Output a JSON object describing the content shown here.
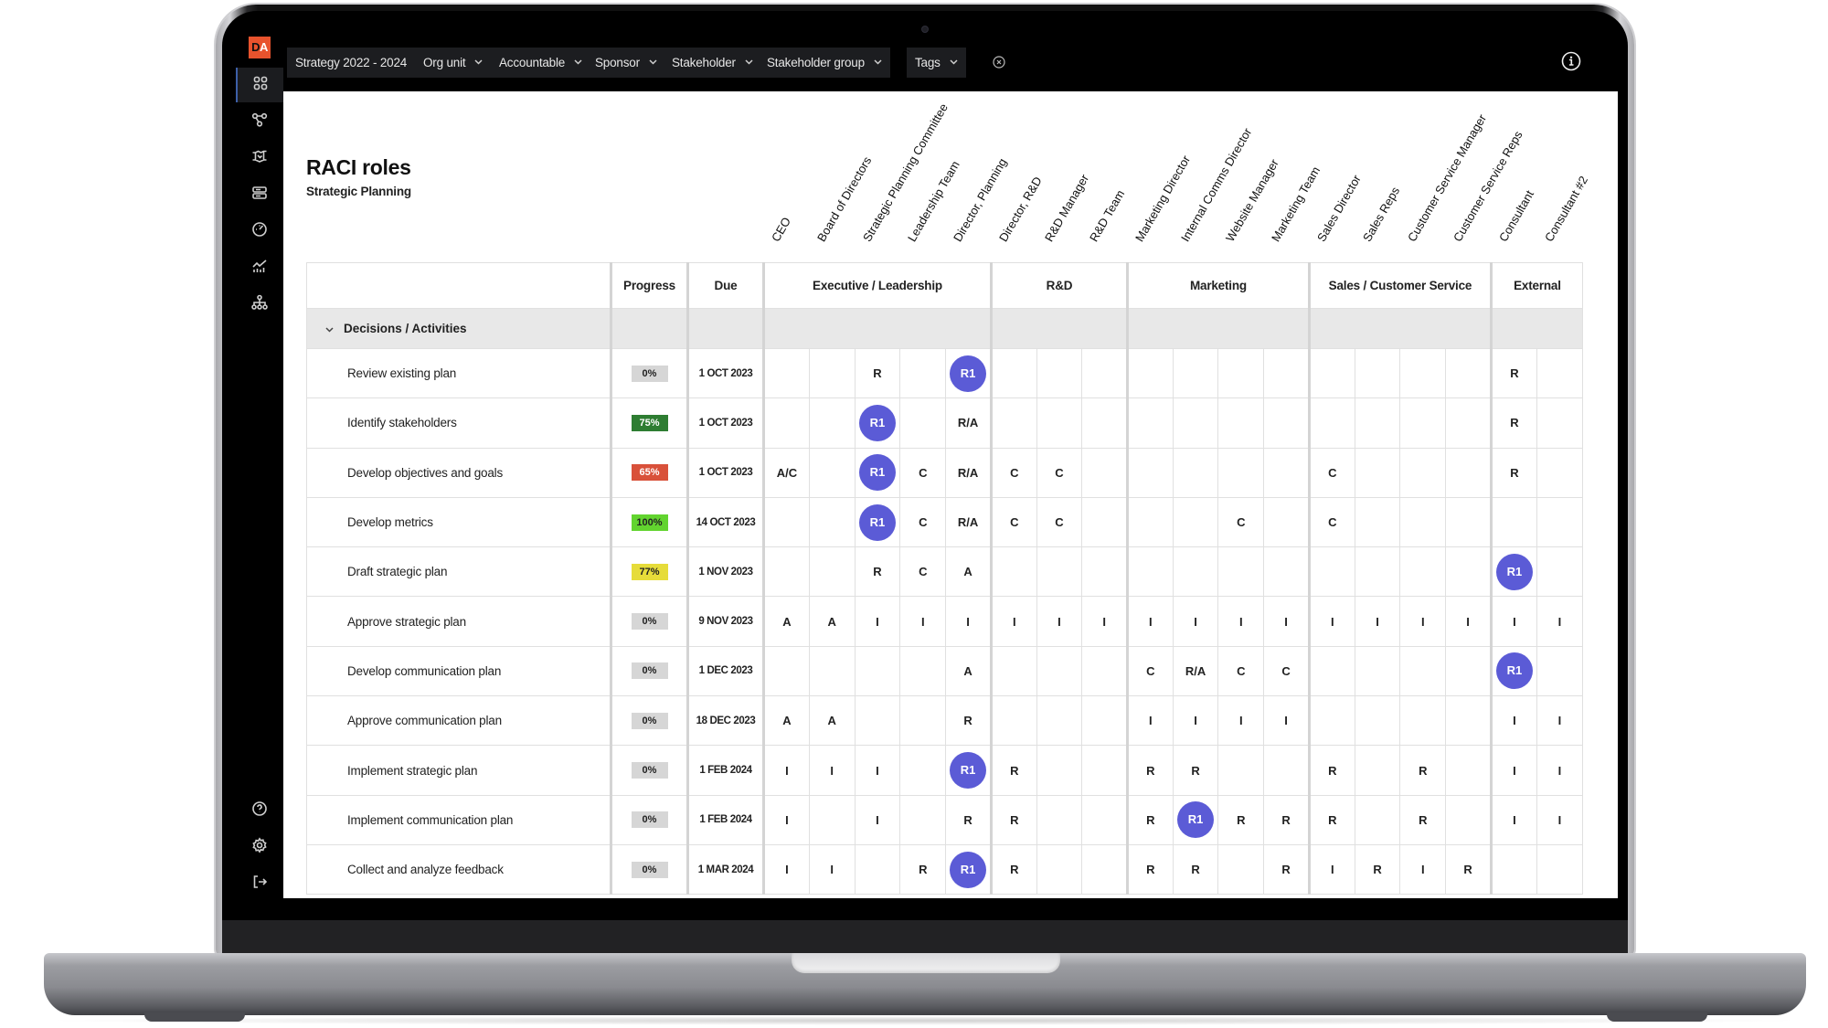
{
  "app": {
    "logo": {
      "first": "D",
      "second": "A"
    },
    "sidebar": {
      "top_items": [
        {
          "name": "dashboard",
          "icon": "grid-icon",
          "active": true
        },
        {
          "name": "relationships",
          "icon": "nodes-icon",
          "active": false
        },
        {
          "name": "handshake",
          "icon": "handshake-icon",
          "active": false
        },
        {
          "name": "layers",
          "icon": "stack-icon",
          "active": false
        },
        {
          "name": "performance",
          "icon": "gauge-icon",
          "active": false
        },
        {
          "name": "analytics",
          "icon": "chart-icon",
          "active": false
        },
        {
          "name": "org-chart",
          "icon": "hierarchy-icon",
          "active": false
        }
      ],
      "bottom_items": [
        {
          "name": "help",
          "icon": "help-icon"
        },
        {
          "name": "settings",
          "icon": "gear-icon"
        },
        {
          "name": "logout",
          "icon": "logout-icon"
        }
      ]
    },
    "filters": [
      {
        "label": "Strategy 2022 - 2024"
      },
      {
        "label": "Org unit"
      },
      {
        "label": "Accountable"
      },
      {
        "label": "Sponsor"
      },
      {
        "label": "Stakeholder"
      },
      {
        "label": "Stakeholder group"
      },
      {
        "label": "Tags"
      }
    ],
    "clear_filters_icon": "close-circle-icon",
    "info_icon": "info-icon"
  },
  "page": {
    "title": "RACI roles",
    "subtitle": "Strategic Planning"
  },
  "table": {
    "headers": {
      "activity": "",
      "progress": "Progress",
      "due": "Due"
    },
    "groups": [
      {
        "label": "Executive / Leadership",
        "span": 5
      },
      {
        "label": "R&D",
        "span": 3
      },
      {
        "label": "Marketing",
        "span": 4
      },
      {
        "label": "Sales / Customer Service",
        "span": 4
      },
      {
        "label": "External",
        "span": 2
      }
    ],
    "roles": [
      "CEO",
      "Board of Directors",
      "Strategic Planning Committee",
      "Leadership Team",
      "Director, Planning",
      "Director, R&D",
      "R&D Manager",
      "R&D Team",
      "Marketing Director",
      "Internal Comms Director",
      "Website Manager",
      "Marketing Team",
      "Sales Director",
      "Sales Reps",
      "Customer Service Manager",
      "Customer  Service Reps",
      "Consultant",
      "Consultant #2"
    ],
    "section": {
      "label": "Decisions / Activities",
      "expanded": true
    },
    "progress_colors": {
      "0": "#d6d6d6",
      "65": "#d9513a",
      "75": "#2e7d32",
      "77": "#e6dc3a",
      "100": "#62d42f"
    },
    "r1_color": "#5b5bd6",
    "rows": [
      {
        "activity": "Review existing plan",
        "progress": "0%",
        "progress_value": 0,
        "due": "1 OCT 2023",
        "cells": [
          "",
          "",
          "R",
          "",
          "R1",
          "",
          "",
          "",
          "",
          "",
          "",
          "",
          "",
          "",
          "",
          "",
          "R",
          ""
        ]
      },
      {
        "activity": "Identify stakeholders",
        "progress": "75%",
        "progress_value": 75,
        "due": "1 OCT 2023",
        "cells": [
          "",
          "",
          "R1",
          "",
          "R/A",
          "",
          "",
          "",
          "",
          "",
          "",
          "",
          "",
          "",
          "",
          "",
          "R",
          ""
        ]
      },
      {
        "activity": "Develop objectives and goals",
        "progress": "65%",
        "progress_value": 65,
        "due": "1 OCT 2023",
        "cells": [
          "A/C",
          "",
          "R1",
          "C",
          "R/A",
          "C",
          "C",
          "",
          "",
          "",
          "",
          "",
          "C",
          "",
          "",
          "",
          "R",
          ""
        ]
      },
      {
        "activity": "Develop metrics",
        "progress": "100%",
        "progress_value": 100,
        "due": "14 OCT 2023",
        "cells": [
          "",
          "",
          "R1",
          "C",
          "R/A",
          "C",
          "C",
          "",
          "",
          "",
          "C",
          "",
          "C",
          "",
          "",
          "",
          "",
          ""
        ]
      },
      {
        "activity": "Draft strategic plan",
        "progress": "77%",
        "progress_value": 77,
        "due": "1 NOV 2023",
        "cells": [
          "",
          "",
          "R",
          "C",
          "A",
          "",
          "",
          "",
          "",
          "",
          "",
          "",
          "",
          "",
          "",
          "",
          "R1",
          ""
        ]
      },
      {
        "activity": "Approve strategic plan",
        "progress": "0%",
        "progress_value": 0,
        "due": "9 NOV 2023",
        "cells": [
          "A",
          "A",
          "I",
          "I",
          "I",
          "I",
          "I",
          "I",
          "I",
          "I",
          "I",
          "I",
          "I",
          "I",
          "I",
          "I",
          "I",
          "I"
        ]
      },
      {
        "activity": "Develop communication plan",
        "progress": "0%",
        "progress_value": 0,
        "due": "1 DEC 2023",
        "cells": [
          "",
          "",
          "",
          "",
          "A",
          "",
          "",
          "",
          "C",
          "R/A",
          "C",
          "C",
          "",
          "",
          "",
          "",
          "R1",
          ""
        ]
      },
      {
        "activity": "Approve communication plan",
        "progress": "0%",
        "progress_value": 0,
        "due": "18 DEC 2023",
        "cells": [
          "A",
          "A",
          "",
          "",
          "R",
          "",
          "",
          "",
          "I",
          "I",
          "I",
          "I",
          "",
          "",
          "",
          "",
          "I",
          "I"
        ]
      },
      {
        "activity": "Implement strategic plan",
        "progress": "0%",
        "progress_value": 0,
        "due": "1 FEB 2024",
        "cells": [
          "I",
          "I",
          "I",
          "",
          "R1",
          "R",
          "",
          "",
          "R",
          "R",
          "",
          "",
          "R",
          "",
          "R",
          "",
          "I",
          "I"
        ]
      },
      {
        "activity": "Implement communication plan",
        "progress": "0%",
        "progress_value": 0,
        "due": "1 FEB 2024",
        "cells": [
          "I",
          "",
          "I",
          "",
          "R",
          "R",
          "",
          "",
          "R",
          "R1",
          "R",
          "R",
          "R",
          "",
          "R",
          "",
          "I",
          "I"
        ]
      },
      {
        "activity": "Collect and analyze feedback",
        "progress": "0%",
        "progress_value": 0,
        "due": "1 MAR 2024",
        "cells": [
          "I",
          "I",
          "",
          "R",
          "R1",
          "R",
          "",
          "",
          "R",
          "R",
          "",
          "R",
          "I",
          "R",
          "I",
          "R",
          "",
          ""
        ]
      }
    ]
  }
}
